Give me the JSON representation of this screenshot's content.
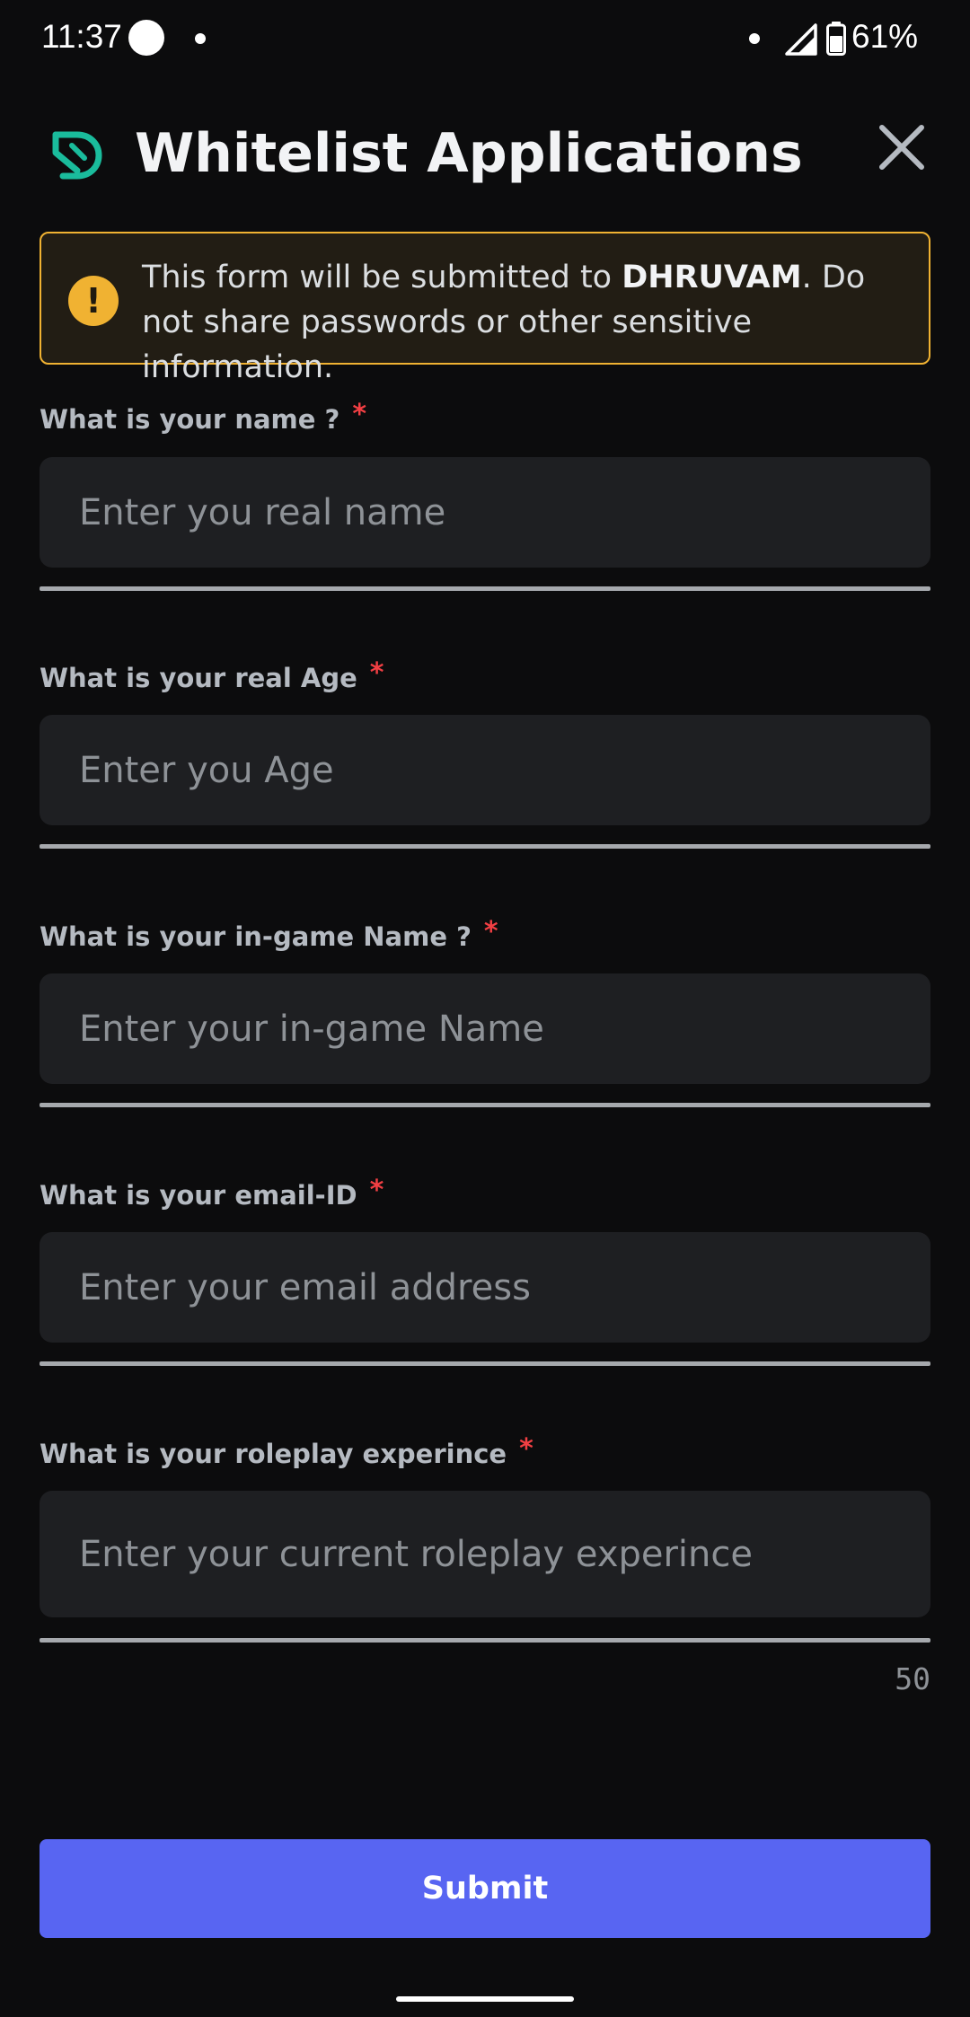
{
  "status_bar": {
    "time": "11:37",
    "battery": "61%"
  },
  "header": {
    "title": "Whitelist Applications",
    "logo_icon": "app-logo-icon",
    "close_icon": "close-icon",
    "accent_color": "#1abc9c"
  },
  "warning": {
    "text_before": "This form will be submitted to ",
    "server_name": "DHRUVAM",
    "text_after": ". Do not share passwords or other sensitive information.",
    "icon": "!",
    "color": "#f0b232"
  },
  "form": {
    "required_marker": "*",
    "fields": [
      {
        "label": "What is your name ?",
        "placeholder": "Enter you real name",
        "value": ""
      },
      {
        "label": "What is your real Age",
        "placeholder": "Enter you Age",
        "value": ""
      },
      {
        "label": "What is your in-game Name ?",
        "placeholder": "Enter your in-game Name",
        "value": ""
      },
      {
        "label": "What is your email-ID",
        "placeholder": "Enter your email address",
        "value": ""
      },
      {
        "label": "What is your roleplay experince",
        "placeholder": "Enter your current roleplay experince",
        "value": "",
        "char_count": "50"
      }
    ]
  },
  "submit": {
    "label": "Submit",
    "color": "#5865f2"
  }
}
